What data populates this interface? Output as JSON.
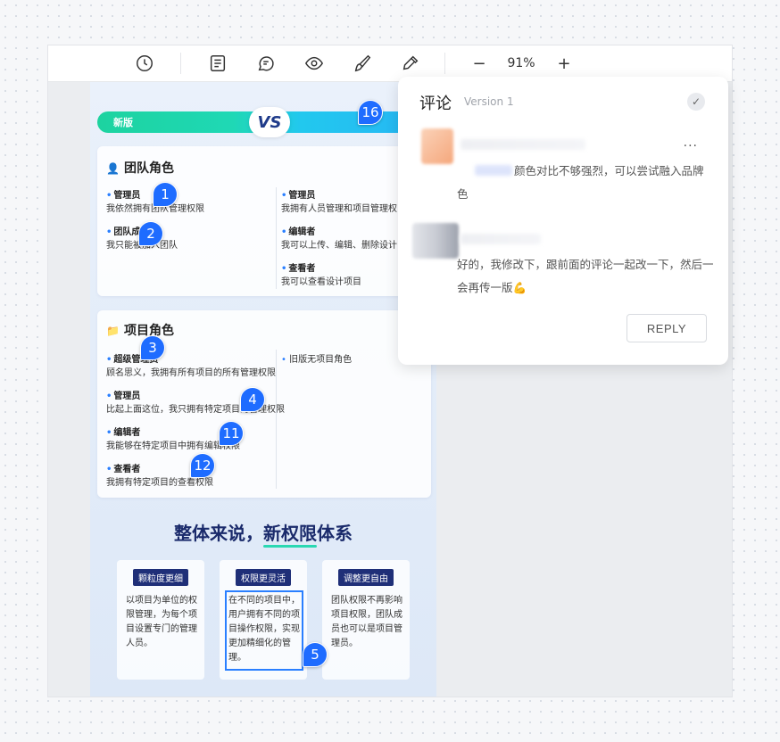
{
  "toolbar": {
    "icons": [
      "history-icon",
      "document-icon",
      "comment-icon",
      "eye-icon",
      "brush-icon",
      "eyedropper-icon"
    ],
    "zoom_minus": "−",
    "zoom_value": "91%",
    "zoom_plus": "+"
  },
  "design": {
    "vs_new_label": "新版",
    "vs_label": "VS",
    "team_roles": {
      "title": "团队角色",
      "left": [
        {
          "name": "管理员",
          "desc": "我依然拥有团队管理权限"
        },
        {
          "name": "团队成员",
          "desc": "我只能被加入团队"
        }
      ],
      "right": [
        {
          "name": "管理员",
          "desc": "我拥有人员管理和项目管理权"
        },
        {
          "name": "编辑者",
          "desc": "我可以上传、编辑、删除设计"
        },
        {
          "name": "查看者",
          "desc": "我可以查看设计项目"
        }
      ]
    },
    "project_roles": {
      "title": "项目角色",
      "left": [
        {
          "name": "超级管理员",
          "desc": "顾名思义，我拥有所有项目的所有管理权限"
        },
        {
          "name": "管理员",
          "desc": "比起上面这位，我只拥有特定项目的管理权限"
        },
        {
          "name": "编辑者",
          "desc": "我能够在特定项目中拥有编辑权限"
        },
        {
          "name": "查看者",
          "desc": "我拥有特定项目的查看权限"
        }
      ],
      "right": [
        {
          "name": "旧版无项目角色",
          "desc": ""
        }
      ]
    },
    "summary": {
      "title_prefix": "整体来说，",
      "title_accent": "新权限",
      "title_suffix": "体系"
    },
    "features": [
      {
        "tag": "颗粒度更细",
        "text": "以项目为单位的权限管理，为每个项目设置专门的管理人员。"
      },
      {
        "tag": "权限更灵活",
        "text": "在不同的项目中，用户拥有不同的项目操作权限，实现更加精细化的管理。"
      },
      {
        "tag": "调整更自由",
        "text": "团队权限不再影响项目权限，团队成员也可以是项目管理员。"
      }
    ],
    "pins": [
      "1",
      "2",
      "3",
      "4",
      "11",
      "12",
      "5",
      "16"
    ]
  },
  "comments": {
    "title": "评论",
    "version": "Version 1",
    "check": "✓",
    "more": "···",
    "items": [
      {
        "text": "颜色对比不够强烈，可以尝试融入品牌色"
      },
      {
        "text": "好的，我修改下，跟前面的评论一起改一下，然后一会再传一版💪"
      }
    ],
    "reply_label": "REPLY"
  }
}
